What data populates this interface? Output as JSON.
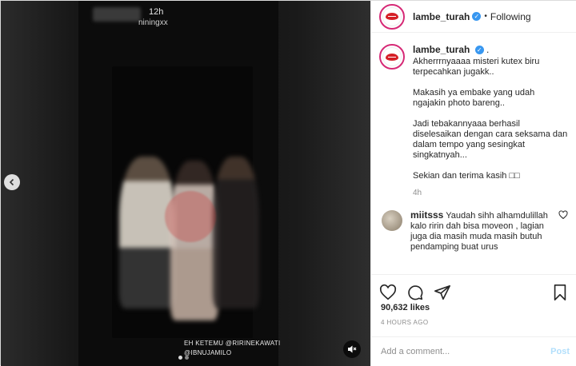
{
  "header": {
    "username": "lambe_turah",
    "separator": "•",
    "follow_status": "Following"
  },
  "media": {
    "story_time": "12h",
    "story_user": "niningxx",
    "story_caption_line1": "EH KETEMU @RIRINEKAWATI",
    "story_caption_line2": "@IBNUJAMILO",
    "icons": {
      "previous": "chevron-left-icon",
      "mute": "muted-speaker-icon"
    }
  },
  "caption": {
    "username": "lambe_turah",
    "suffix": ".",
    "paragraphs": [
      "Akherrrnyaaaa misteri kutex biru terpecahkan jugakk..",
      "Makasih ya embake yang udah ngajakin photo bareng..",
      "Jadi tebakannyaaa berhasil diselesaikan dengan cara seksama dan dalam tempo yang sesingkat singkatnyah...",
      "Sekian dan terima kasih □□"
    ],
    "time": "4h"
  },
  "comment": {
    "username": "miitsss",
    "text": "Yaudah sihh alhamdulillah kalo ririn dah bisa moveon , lagian juga dia masih muda masih butuh pendamping buat urus"
  },
  "actions": {
    "likes": "90,632 likes",
    "posted": "4 HOURS AGO"
  },
  "add_comment": {
    "placeholder": "Add a comment...",
    "post_label": "Post"
  },
  "colors": {
    "verified": "#3897f0",
    "ring": "#d62976",
    "post_button": "#b2dffc"
  }
}
